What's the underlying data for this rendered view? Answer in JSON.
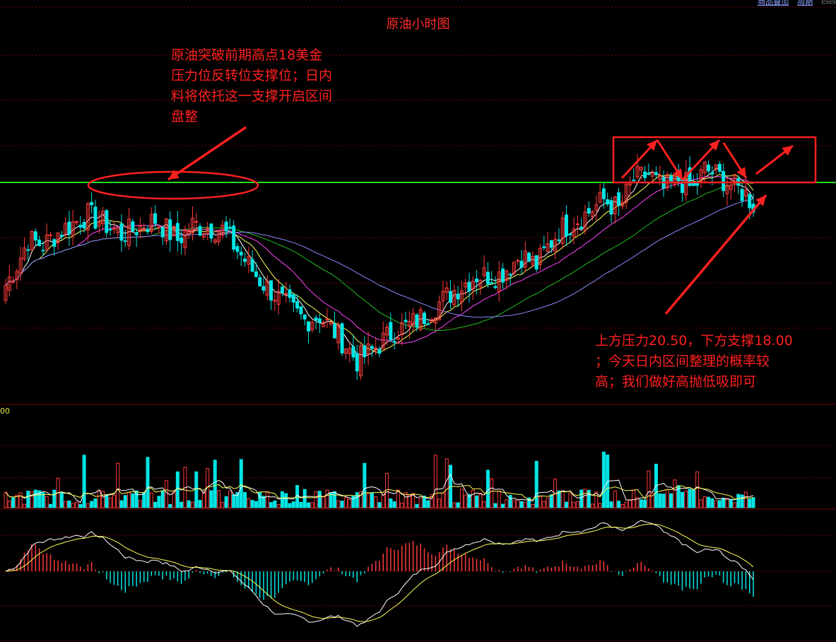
{
  "title": "原油小时图",
  "toolbar": {
    "item1": "商品叠加",
    "item2": "周期"
  },
  "annotations": {
    "left_note": [
      "原油突破前期高点18美金",
      "压力位反转位支撑位；日内",
      "料将依托这一支撑开启区间",
      "盘整"
    ],
    "right_note": [
      "上方压力20.50，下方支撑18.00",
      "；今天日内区间整理的概率较",
      "高；我们做好高抛低吸即可"
    ]
  },
  "volume_panel_label": "00",
  "colors": {
    "up": "#ff3b3b",
    "down": "#00e5e5",
    "grid": "#7a0000",
    "support_line": "#22dd22",
    "ma5": "#ffffff",
    "ma10": "#ffff55",
    "ma20": "#ff44ff",
    "ma40": "#22bb22",
    "ma60": "#8888ff",
    "annotation": "#ff2020"
  },
  "chart_data": {
    "type": "candlestick",
    "title": "原油小时图",
    "support_level": 18.0,
    "resistance_level": 20.5,
    "trend_points": [
      [
        0,
        16.5
      ],
      [
        3,
        16.9
      ],
      [
        6,
        17.4
      ],
      [
        10,
        17.3
      ],
      [
        15,
        17.6
      ],
      [
        22,
        17.9
      ],
      [
        27,
        17.7
      ],
      [
        31,
        17.5
      ],
      [
        40,
        17.8
      ],
      [
        46,
        17.4
      ],
      [
        50,
        17.7
      ],
      [
        58,
        17.6
      ],
      [
        62,
        17.2
      ],
      [
        68,
        16.6
      ],
      [
        75,
        16.1
      ],
      [
        80,
        15.8
      ],
      [
        84,
        15.9
      ],
      [
        90,
        15.4
      ],
      [
        94,
        15.0
      ],
      [
        98,
        15.2
      ],
      [
        104,
        15.6
      ],
      [
        108,
        15.7
      ],
      [
        112,
        15.9
      ],
      [
        120,
        16.4
      ],
      [
        126,
        16.7
      ],
      [
        132,
        16.7
      ],
      [
        138,
        17.1
      ],
      [
        142,
        16.9
      ],
      [
        148,
        17.6
      ],
      [
        155,
        17.9
      ],
      [
        160,
        18.2
      ],
      [
        164,
        18.0
      ],
      [
        168,
        18.6
      ],
      [
        172,
        18.7
      ],
      [
        176,
        18.4
      ],
      [
        180,
        18.6
      ],
      [
        184,
        18.4
      ],
      [
        187,
        18.8
      ],
      [
        190,
        18.7
      ],
      [
        194,
        18.5
      ],
      [
        198,
        18.3
      ],
      [
        200,
        18.1
      ]
    ],
    "n_candles": 201
  }
}
